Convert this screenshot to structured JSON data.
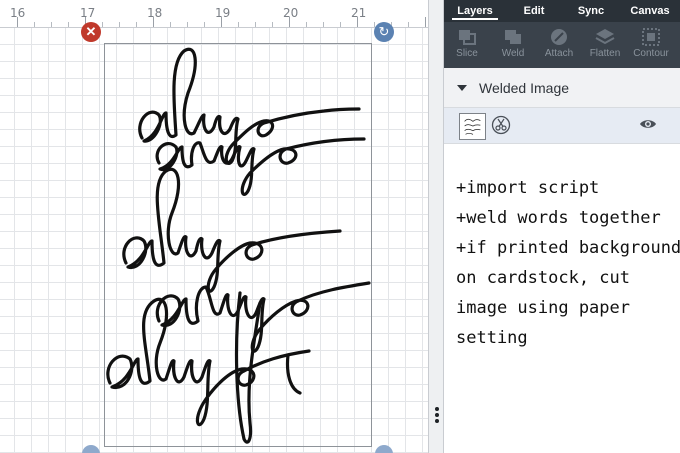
{
  "ruler": {
    "labels": [
      "16",
      "17",
      "18",
      "19",
      "20",
      "21"
    ]
  },
  "canvas": {
    "delete_icon": "x-icon",
    "rotate_icon": "rotate-icon",
    "artwork": "handwritten always script"
  },
  "panel": {
    "tabs": [
      {
        "label": "Layers",
        "active": true
      },
      {
        "label": "Edit",
        "active": false
      },
      {
        "label": "Sync",
        "active": false
      },
      {
        "label": "Canvas",
        "active": false
      }
    ],
    "toolbar": [
      {
        "label": "Slice",
        "icon": "slice-icon"
      },
      {
        "label": "Weld",
        "icon": "weld-icon"
      },
      {
        "label": "Attach",
        "icon": "attach-icon"
      },
      {
        "label": "Flatten",
        "icon": "flatten-icon"
      },
      {
        "label": "Contour",
        "icon": "contour-icon"
      }
    ],
    "layer_group": {
      "title": "Welded Image",
      "expanded": true
    },
    "layer": {
      "operation_icon": "scissors-icon",
      "visibility_icon": "eye-icon"
    },
    "notes": [
      "+import script",
      "+weld words together",
      "+if printed background",
      "on cardstock, cut",
      "image using paper",
      "setting"
    ]
  },
  "colors": {
    "tab_bar": "#2a3138",
    "toolbar": "#3a424b",
    "delete_handle": "#c0392b",
    "rotate_handle": "#5b82b2",
    "layer_selected": "#e6ebf3"
  }
}
